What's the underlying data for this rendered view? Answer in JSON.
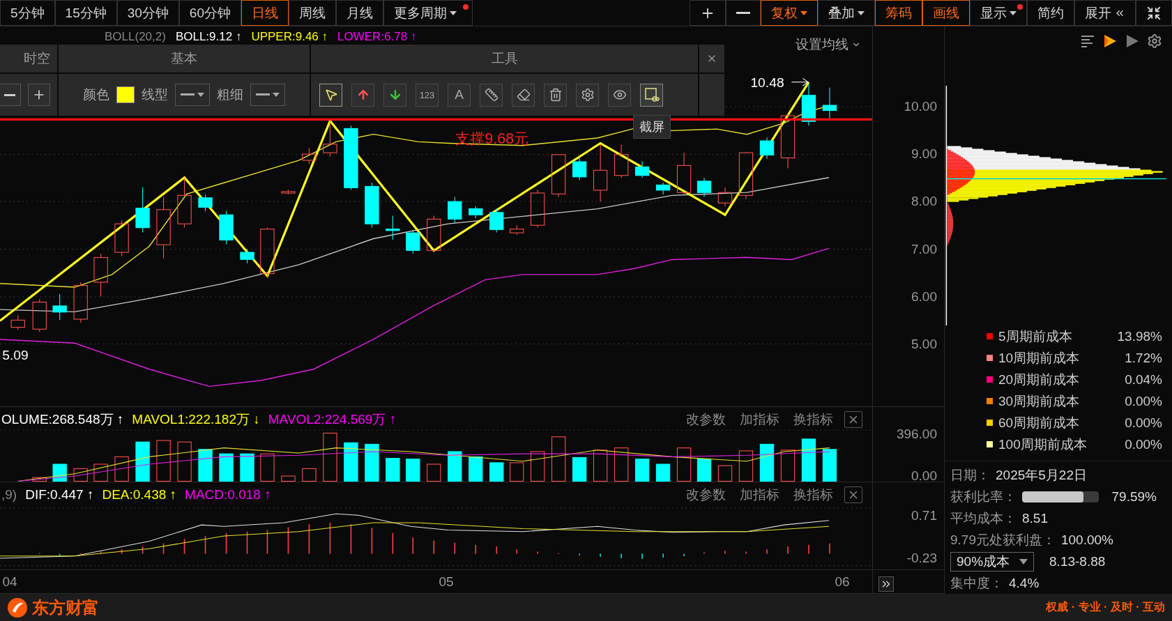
{
  "period_bar": {
    "periods": [
      {
        "label": "5分钟",
        "selected": false,
        "dropdown": false,
        "dot": false
      },
      {
        "label": "15分钟",
        "selected": false,
        "dropdown": false,
        "dot": false
      },
      {
        "label": "30分钟",
        "selected": false,
        "dropdown": false,
        "dot": false
      },
      {
        "label": "60分钟",
        "selected": false,
        "dropdown": false,
        "dot": false
      },
      {
        "label": "日线",
        "selected": true,
        "dropdown": false,
        "dot": false
      },
      {
        "label": "周线",
        "selected": false,
        "dropdown": false,
        "dot": false
      },
      {
        "label": "月线",
        "selected": false,
        "dropdown": false,
        "dot": false
      },
      {
        "label": "更多周期",
        "selected": false,
        "dropdown": true,
        "dot": true
      }
    ],
    "actions": [
      {
        "kind": "plus"
      },
      {
        "kind": "minus"
      },
      {
        "kind": "text",
        "label": "复权",
        "active": true,
        "dropdown": true,
        "dot": false
      },
      {
        "kind": "text",
        "label": "叠加",
        "active": false,
        "dropdown": true,
        "dot": false
      },
      {
        "kind": "text",
        "label": "筹码",
        "active": true,
        "dropdown": false,
        "dot": false
      },
      {
        "kind": "text",
        "label": "画线",
        "active": true,
        "dropdown": false,
        "dot": false
      },
      {
        "kind": "text",
        "label": "显示",
        "active": false,
        "dropdown": true,
        "dot": true
      },
      {
        "kind": "text",
        "label": "简约",
        "active": false,
        "dropdown": false,
        "dot": false
      },
      {
        "kind": "expand",
        "label": "展开"
      },
      {
        "kind": "compress"
      }
    ]
  },
  "main_chart": {
    "indicator": {
      "name": "BOLL(20,2)",
      "values": [
        {
          "text": "BOLL:9.12",
          "arrow": "↑",
          "color": "#ffffff"
        },
        {
          "text": "UPPER:9.46",
          "arrow": "↑",
          "color": "#ffff00"
        },
        {
          "text": "LOWER:6.78",
          "arrow": "↑",
          "color": "#ff00ff"
        }
      ]
    },
    "ma_setting": "设置均线",
    "high_label": "10.48",
    "low_label": "5.09",
    "support_label": "支撑9.68元",
    "price_ticks": [
      "10.00",
      "9.00",
      "8.00",
      "7.00",
      "6.00",
      "5.00"
    ]
  },
  "draw_toolbar": {
    "left_section": {
      "title": "时空"
    },
    "basic_section": {
      "title": "基本",
      "color_label": "颜色",
      "swatch": {
        "color": "#ffff00"
      },
      "line_type_label": "线型",
      "width_label": "粗细"
    },
    "tools_section": {
      "title": "工具",
      "tools": [
        {
          "kind": "cursor",
          "selected": true
        },
        {
          "kind": "up",
          "selected": false
        },
        {
          "kind": "down",
          "selected": false
        },
        {
          "kind": "number",
          "label": "123",
          "selected": false
        },
        {
          "kind": "text",
          "label": "A",
          "selected": false
        },
        {
          "kind": "ruler",
          "selected": false
        },
        {
          "kind": "eraser",
          "selected": false
        },
        {
          "kind": "trash",
          "selected": false
        },
        {
          "kind": "gear",
          "selected": false
        },
        {
          "kind": "eye",
          "selected": false
        },
        {
          "kind": "screenshot",
          "selected": false,
          "tooltip": "截屏"
        }
      ]
    }
  },
  "volume_panel": {
    "values": [
      {
        "text": "OLUME:268.548万",
        "arrow": "↑",
        "color": "#ffffff"
      },
      {
        "text": "MAVOL1:222.182万",
        "arrow": "↓",
        "color": "#ffff00"
      },
      {
        "text": "MAVOL2:224.569万",
        "arrow": "↑",
        "color": "#ff00ff"
      }
    ],
    "actions": [
      "改参数",
      "加指标",
      "换指标"
    ],
    "ticks": [
      "396.00",
      "0.00"
    ]
  },
  "macd_panel": {
    "params": ",9)",
    "values": [
      {
        "text": "DIF:0.447",
        "arrow": "↑",
        "color": "#ffffff"
      },
      {
        "text": "DEA:0.438",
        "arrow": "↑",
        "color": "#ffff00"
      },
      {
        "text": "MACD:0.018",
        "arrow": "↑",
        "color": "#ff00ff"
      }
    ],
    "actions": [
      "改参数",
      "加指标",
      "换指标"
    ],
    "ticks": [
      "0.71",
      "-0.23"
    ]
  },
  "date_axis": [
    "04",
    "05",
    "06"
  ],
  "chip_panel": {
    "legend": [
      {
        "label": "5周期前成本",
        "value": "13.98%",
        "color": "#ff0000"
      },
      {
        "label": "10周期前成本",
        "value": "1.72%",
        "color": "#ff8080"
      },
      {
        "label": "20周期前成本",
        "value": "0.04%",
        "color": "#ff0080"
      },
      {
        "label": "30周期前成本",
        "value": "0.00%",
        "color": "#ff8000"
      },
      {
        "label": "60周期前成本",
        "value": "0.00%",
        "color": "#ffcc00"
      },
      {
        "label": "100周期前成本",
        "value": "0.00%",
        "color": "#ffffa0"
      }
    ],
    "date": {
      "label": "日期：",
      "value": "2025年5月22日"
    },
    "profit_ratio": {
      "label": "获利比率：",
      "level": 0.7959,
      "value": "79.59%"
    },
    "avg_cost": {
      "label": "平均成本：",
      "value": "8.51"
    },
    "profit_at": {
      "label": "9.79元处获利盘：",
      "value": "100.00%"
    },
    "cost_range": {
      "select": "90%成本",
      "value": "8.13-8.88"
    },
    "concentration": {
      "label": "集中度：",
      "value": "4.4%"
    }
  },
  "footer": {
    "brand": "东方财富",
    "slogan": "权威 · 专业 · 及时 · 互动"
  }
}
